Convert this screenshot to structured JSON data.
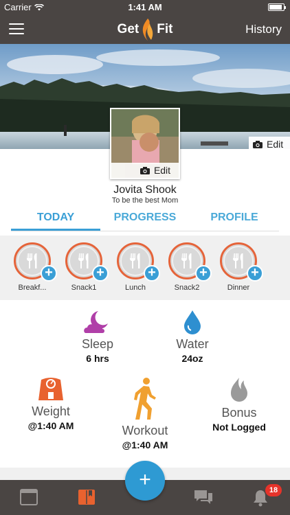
{
  "status_bar": {
    "carrier": "Carrier",
    "time": "1:41 AM"
  },
  "nav": {
    "logo_left": "Get",
    "logo_right": "Fit",
    "history_label": "History"
  },
  "cover": {
    "edit_label": "Edit"
  },
  "avatar": {
    "edit_label": "Edit"
  },
  "user": {
    "name": "Jovita Shook",
    "motto": "To be the best Mom"
  },
  "tabs": [
    {
      "label": "TODAY",
      "active": true
    },
    {
      "label": "PROGRESS",
      "active": false
    },
    {
      "label": "PROFILE",
      "active": false
    }
  ],
  "meals": [
    {
      "label": "Breakf..."
    },
    {
      "label": "Snack1"
    },
    {
      "label": "Lunch"
    },
    {
      "label": "Snack2"
    },
    {
      "label": "Dinner"
    }
  ],
  "stats": {
    "sleep": {
      "title": "Sleep",
      "value": "6 hrs",
      "color": "#b03fa8"
    },
    "water": {
      "title": "Water",
      "value": "24oz",
      "color": "#2e8fd0"
    },
    "weight": {
      "title": "Weight",
      "value": "@1:40 AM",
      "color": "#e8622f"
    },
    "workout": {
      "title": "Workout",
      "value": "@1:40 AM",
      "color": "#f0a030"
    },
    "bonus": {
      "title": "Bonus",
      "value": "Not Logged",
      "color": "#9a9a9a"
    }
  },
  "bottom_bar": {
    "notification_count": "18",
    "fab_label": "+"
  }
}
